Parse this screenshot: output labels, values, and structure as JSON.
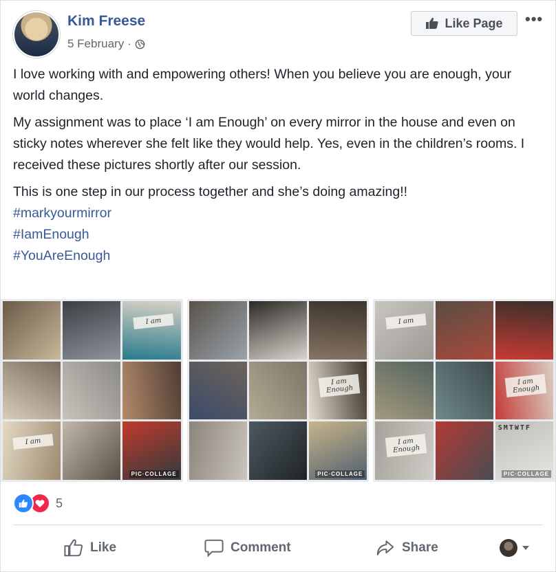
{
  "post": {
    "author": "Kim Freese",
    "date": "5 February",
    "separator": "·",
    "privacy_icon": "globe-icon",
    "like_page_label": "Like Page",
    "more_label": "•••",
    "paragraphs": [
      "I love working with and empowering others! When you believe you are enough, your world changes.",
      "My assignment was to place ‘I am Enough’ on every mirror in the house and even on sticky notes wherever she felt like they would help. Yes, even in the children’s rooms. I received these pictures shortly after our session.",
      "This is one step in our process together and she’s doing amazing!!"
    ],
    "hashtags": [
      "#markyourmirror",
      "#IamEnough",
      "#YouAreEnough"
    ]
  },
  "gallery": {
    "watermark": "PIC·COLLAGE",
    "calendar_text": "SMTWTF",
    "collages": [
      {
        "tiles": [
          {
            "c": [
              "#6b5a48",
              "#c9b79a"
            ],
            "note": ""
          },
          {
            "c": [
              "#3c3f44",
              "#8e949b"
            ],
            "note": ""
          },
          {
            "c": [
              "#d7d2c6",
              "#2a7b8c"
            ],
            "note": "I am"
          },
          {
            "c": [
              "#7a6d5e",
              "#d8cdbb"
            ],
            "note": ""
          },
          {
            "c": [
              "#8c8a86",
              "#c7c3bc"
            ],
            "note": ""
          },
          {
            "c": [
              "#4e3e34",
              "#b48a6a"
            ],
            "note": ""
          },
          {
            "c": [
              "#9c8a70",
              "#e4d9c4"
            ],
            "note": "I am"
          },
          {
            "c": [
              "#5a5046",
              "#c2b8aa"
            ],
            "note": ""
          },
          {
            "c": [
              "#2f3a3f",
              "#c23a2a"
            ],
            "note": ""
          }
        ]
      },
      {
        "tiles": [
          {
            "c": [
              "#59524a",
              "#9aa3ab"
            ],
            "note": ""
          },
          {
            "c": [
              "#2c2926",
              "#d9d4cc"
            ],
            "note": ""
          },
          {
            "c": [
              "#3d342c",
              "#857462"
            ],
            "note": ""
          },
          {
            "c": [
              "#6d6459",
              "#3b4a6a"
            ],
            "note": ""
          },
          {
            "c": [
              "#7d7566",
              "#b3aa94"
            ],
            "note": ""
          },
          {
            "c": [
              "#3e3429",
              "#e3ddd0"
            ],
            "note": "I am Enough"
          },
          {
            "c": [
              "#c9c4bd",
              "#8c857c"
            ],
            "note": ""
          },
          {
            "c": [
              "#1f2326",
              "#4d5a61"
            ],
            "note": ""
          },
          {
            "c": [
              "#4f6070",
              "#c8b48a"
            ],
            "note": ""
          }
        ]
      },
      {
        "tiles": [
          {
            "c": [
              "#c8c5c0",
              "#9d9a94"
            ],
            "note": "I am"
          },
          {
            "c": [
              "#5a4d42",
              "#a84a3c"
            ],
            "note": ""
          },
          {
            "c": [
              "#3c2f2a",
              "#c73b33"
            ],
            "note": ""
          },
          {
            "c": [
              "#53635f",
              "#a39a7c"
            ],
            "note": ""
          },
          {
            "c": [
              "#3e4a4e",
              "#6f8a88"
            ],
            "note": ""
          },
          {
            "c": [
              "#d9cfc2",
              "#c43c39"
            ],
            "note": "I am Enough"
          },
          {
            "c": [
              "#cfcbc6",
              "#a6a29b"
            ],
            "note": "I am Enough"
          },
          {
            "c": [
              "#4a4c52",
              "#b33a33"
            ],
            "note": ""
          },
          {
            "c": [
              "#e7e6e2",
              "#bfbdb8"
            ],
            "note": ""
          }
        ]
      }
    ]
  },
  "reactions": {
    "count": "5",
    "types": [
      "like-icon",
      "love-icon"
    ]
  },
  "actions": {
    "like_label": "Like",
    "comment_label": "Comment",
    "share_label": "Share"
  },
  "colors": {
    "link": "#385898",
    "text": "#1d2129",
    "muted": "#616770"
  }
}
